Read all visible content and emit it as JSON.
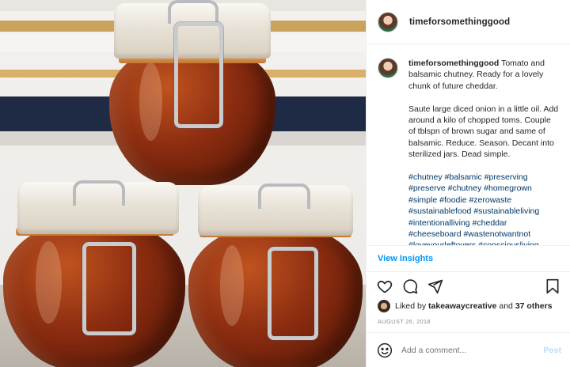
{
  "post": {
    "username": "timeforsomethinggood",
    "caption": {
      "username": "timeforsomethinggood",
      "paragraph1": "Tomato and balsamic chutney. Ready for a lovely chunk of future cheddar.",
      "paragraph2": "Saute large diced onion in a little oil. Add around a kilo of chopped toms. Couple of tblspn of brown sugar and same of balsamic. Reduce. Season. Decant into sterilized jars. Dead simple.",
      "hashtags": "#chutney #balsamic #preserving #preserve #chutney #homegrown #simple #foodie #zerowaste #sustainablefood #sustainableliving #intentionalliving #cheddar #cheeseboard #wastenotwantnot #loveyourleftovers #consciousliving"
    },
    "insights_label": "View Insights",
    "likes": {
      "prefix": "Liked by",
      "user": "takeawaycreative",
      "middle": "and",
      "others": "37 others"
    },
    "date": "AUGUST 26, 2018",
    "comment": {
      "placeholder": "Add a comment...",
      "post_label": "Post"
    }
  },
  "icons": [
    "heart-icon",
    "comment-icon",
    "share-icon",
    "bookmark-icon",
    "emoji-icon"
  ],
  "colors": {
    "link_blue": "#0095f6",
    "hashtag_blue": "#00376b",
    "muted": "#8e8e8e",
    "post_disabled": "#b2dffc",
    "text": "#262626"
  }
}
